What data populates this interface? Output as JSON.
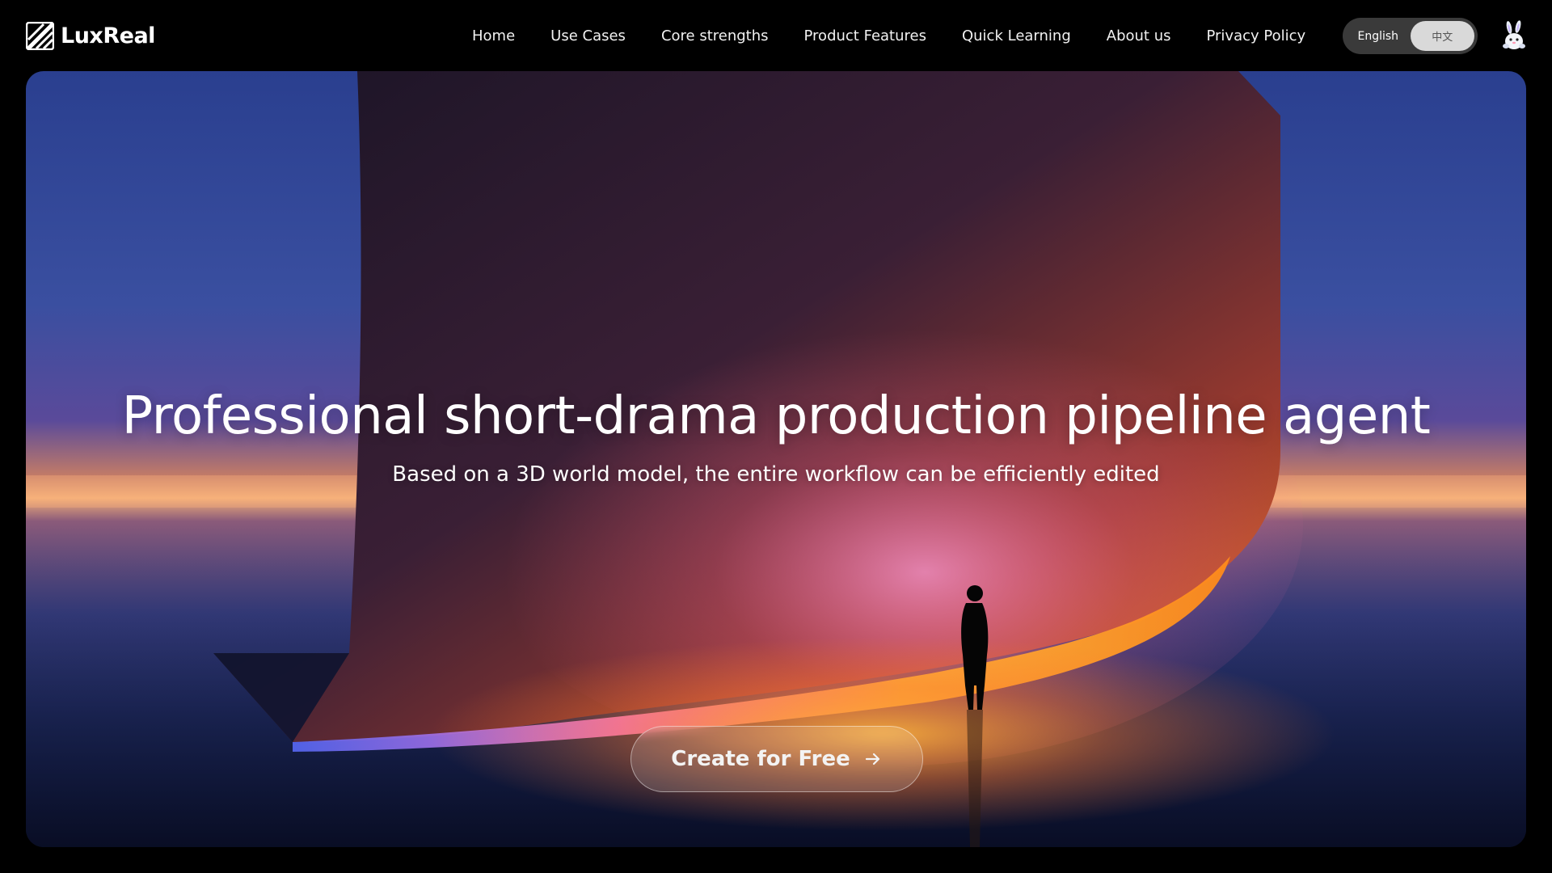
{
  "brand": {
    "name": "LuxReal"
  },
  "nav": {
    "items": [
      {
        "label": "Home"
      },
      {
        "label": "Use Cases"
      },
      {
        "label": "Core strengths"
      },
      {
        "label": "Product Features"
      },
      {
        "label": "Quick Learning"
      },
      {
        "label": "About us"
      },
      {
        "label": "Privacy Policy"
      }
    ]
  },
  "language": {
    "options": [
      "English",
      "中文"
    ],
    "selected": "中文"
  },
  "hero": {
    "title": "Professional short-drama production pipeline agent",
    "subtitle": "Based on a 3D world model, the entire workflow can be efficiently edited",
    "cta_label": "Create for Free"
  },
  "icons": {
    "logo": "luxreal-logo-icon",
    "cta_arrow": "arrow-right-icon",
    "avatar": "rabbit-avatar-icon"
  },
  "colors": {
    "header_bg": "#000000",
    "text": "#ffffff",
    "toggle_bg": "#3a3a3a",
    "toggle_active": "#d9d9d9",
    "glow_orange": "#ff9a2e",
    "glow_pink": "#ff7ad8",
    "sky_blue": "#2e458f"
  }
}
